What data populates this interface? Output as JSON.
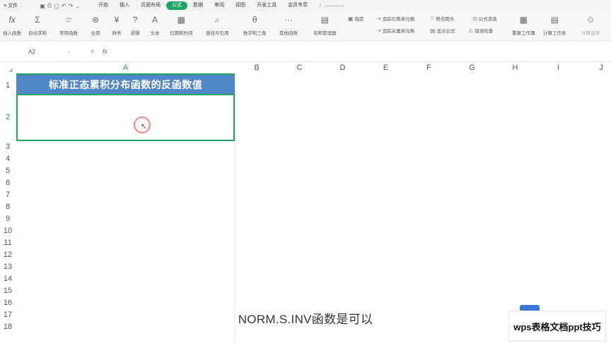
{
  "menu": {
    "file_label": "文件",
    "tabs": [
      {
        "label": "开始",
        "active": false
      },
      {
        "label": "插入",
        "active": false
      },
      {
        "label": "页面布局",
        "active": false
      },
      {
        "label": "公式",
        "active": true
      },
      {
        "label": "数据",
        "active": false
      },
      {
        "label": "审阅",
        "active": false
      },
      {
        "label": "视图",
        "active": false
      },
      {
        "label": "开发工具",
        "active": false
      },
      {
        "label": "会员专享",
        "active": false
      }
    ]
  },
  "ribbon": {
    "buttons": [
      {
        "label": "插入函数",
        "icon": "fx-icon"
      },
      {
        "label": "自动求和",
        "icon": "sigma-icon"
      },
      {
        "label": "常用函数",
        "icon": "star-icon"
      },
      {
        "label": "全部",
        "icon": "all-icon"
      },
      {
        "label": "财务",
        "icon": "finance-icon"
      },
      {
        "label": "逻辑",
        "icon": "logic-icon"
      },
      {
        "label": "文本",
        "icon": "text-icon"
      },
      {
        "label": "日期和时间",
        "icon": "date-icon"
      },
      {
        "label": "查找与引用",
        "icon": "lookup-icon"
      },
      {
        "label": "数学和三角",
        "icon": "math-icon"
      },
      {
        "label": "其他函数",
        "icon": "more-icon"
      },
      {
        "label": "名称管理器",
        "icon": "name-manager-icon"
      },
      {
        "label": "重算工作簿",
        "icon": "recalc-icon"
      },
      {
        "label": "计算工作表",
        "icon": "calc-sheet-icon"
      },
      {
        "label": "计算选项",
        "icon": "calc-options-icon"
      }
    ],
    "small": [
      {
        "label": "指定",
        "icon": "define-icon"
      },
      {
        "label": "追踪引用单元格",
        "icon": "trace-precedents-icon"
      },
      {
        "label": "追踪从属单元格",
        "icon": "trace-dependents-icon"
      },
      {
        "label": "移去箭头",
        "icon": "remove-arrows-icon"
      },
      {
        "label": "显示公式",
        "icon": "show-formulas-icon"
      },
      {
        "label": "公式求值",
        "icon": "evaluate-icon"
      },
      {
        "label": "错误检查",
        "icon": "error-check-icon"
      }
    ]
  },
  "formula_bar": {
    "name_box": "A2",
    "zoom_icon": "zoom-icon",
    "fx_label": "fx"
  },
  "grid": {
    "columns": [
      "A",
      "B",
      "C",
      "D",
      "E",
      "F",
      "G",
      "H",
      "I",
      "J"
    ],
    "rows": [
      "1",
      "2",
      "3",
      "4",
      "5",
      "6",
      "7",
      "8",
      "9",
      "10",
      "11",
      "12",
      "13",
      "14",
      "15",
      "16",
      "17",
      "18"
    ],
    "selected_column": "A",
    "selected_row": "2",
    "title_cell": "标准正态累积分布函数的反函数值",
    "title_color": "#4f86c6",
    "accent_color": "#1fa463"
  },
  "caption": "NORM.S.INV函数是可以",
  "watermark": "wps表格文档ppt技巧"
}
